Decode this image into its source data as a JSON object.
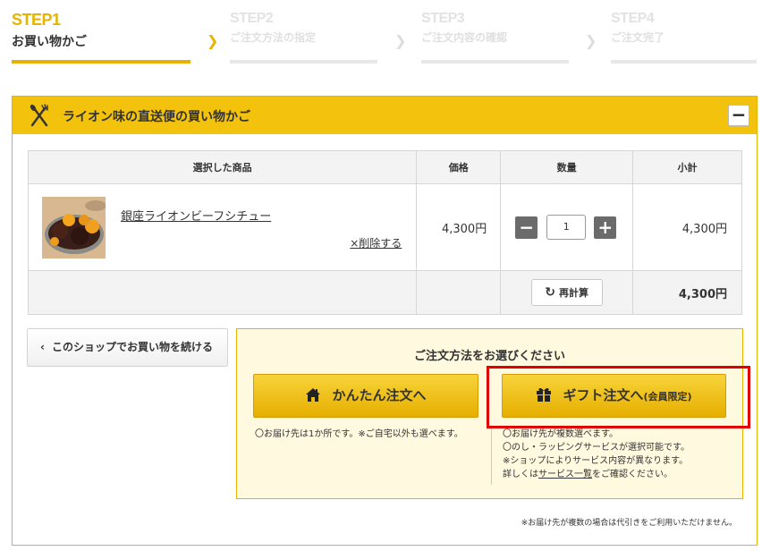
{
  "steps": [
    {
      "num": "STEP1",
      "label": "お買い物かご"
    },
    {
      "num": "STEP2",
      "label": "ご注文方法の指定"
    },
    {
      "num": "STEP3",
      "label": "ご注文内容の確認"
    },
    {
      "num": "STEP4",
      "label": "ご注文完了"
    }
  ],
  "cart": {
    "title": "ライオン味の直送便の買い物かご",
    "collapse_label": "−",
    "headers": {
      "product": "選択した商品",
      "price": "価格",
      "qty": "数量",
      "subtotal": "小計"
    },
    "item": {
      "name": "銀座ライオンビーフシチュー",
      "delete_label": "×削除する",
      "price": "4,300円",
      "qty": "1",
      "subtotal": "4,300円"
    },
    "recalc_label": "再計算",
    "total": "4,300円"
  },
  "continue_label": "このショップでお買い物を続ける",
  "order": {
    "title": "ご注文方法をお選びください",
    "easy_label": "かんたん注文へ",
    "easy_note": "〇お届け先は1か所です。※ご自宅以外も選べます。",
    "gift_label": "ギフト注文へ",
    "gift_small": "(会員限定)",
    "gift_notes": [
      "〇お届け先が複数選べます。",
      "〇のし・ラッピングサービスが選択可能です。",
      "※ショップによりサービス内容が異なります。"
    ],
    "gift_detail_pre": "詳しくは",
    "gift_detail_link": "サービス一覧",
    "gift_detail_post": "をご確認ください。"
  },
  "bottom_note": "※お届け先が複数の場合は代引きをご利用いただけません。",
  "colors": {
    "accent": "#f2c20c",
    "highlight": "#e00000"
  }
}
